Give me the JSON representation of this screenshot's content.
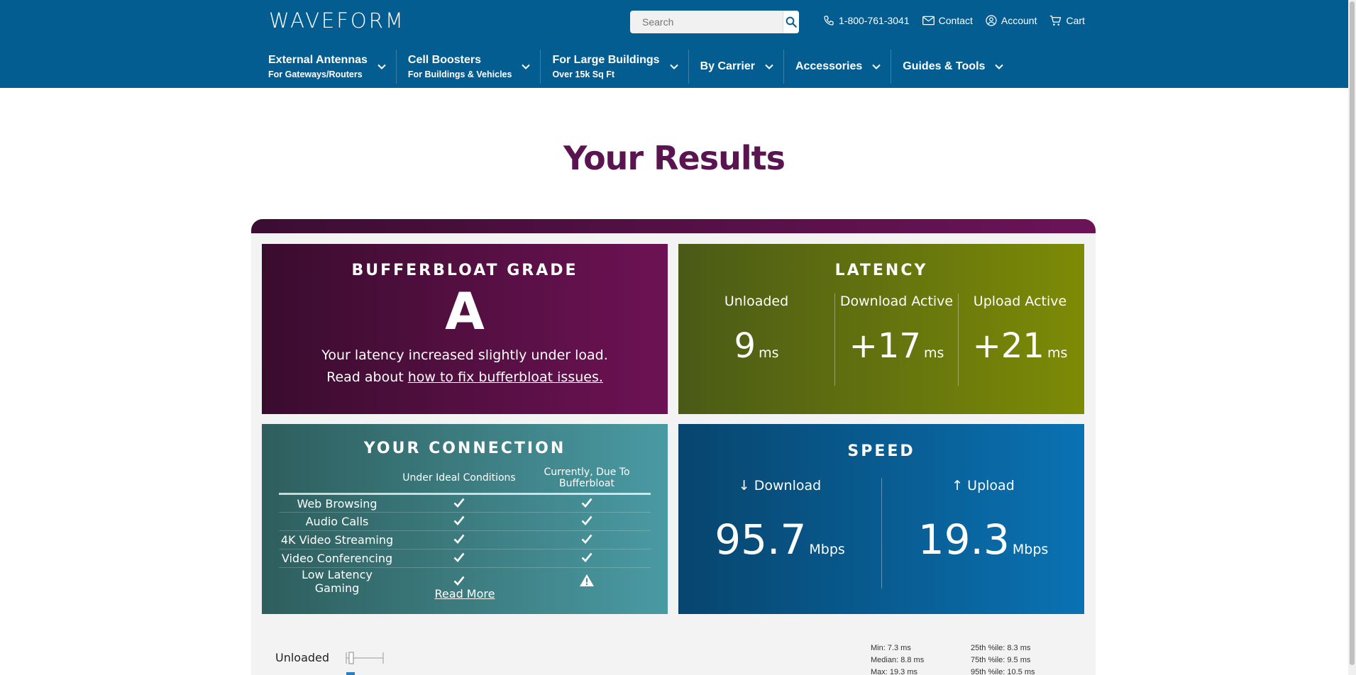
{
  "header": {
    "logo": "WAVEFORM",
    "search": {
      "placeholder": "Search"
    },
    "links": {
      "phone": "1-800-761-3041",
      "contact": "Contact",
      "account": "Account",
      "cart": "Cart"
    },
    "nav": [
      {
        "main": "External Antennas",
        "sub": "For Gateways/Routers"
      },
      {
        "main": "Cell Boosters",
        "sub": "For Buildings & Vehicles"
      },
      {
        "main": "For Large Buildings",
        "sub": "Over 15k Sq Ft"
      },
      {
        "main": "By Carrier",
        "sub": ""
      },
      {
        "main": "Accessories",
        "sub": ""
      },
      {
        "main": "Guides & Tools",
        "sub": ""
      }
    ]
  },
  "page": {
    "title": "Your Results"
  },
  "grade": {
    "heading": "BUFFERBLOAT GRADE",
    "value": "A",
    "message": "Your latency increased slightly under load.",
    "read_prefix": "Read about ",
    "link": "how to fix bufferbloat issues."
  },
  "latency": {
    "heading": "LATENCY",
    "columns": [
      {
        "label": "Unloaded",
        "value": "9",
        "unit": "ms"
      },
      {
        "label": "Download Active",
        "value": "+17",
        "unit": "ms"
      },
      {
        "label": "Upload Active",
        "value": "+21",
        "unit": "ms"
      }
    ]
  },
  "connection": {
    "heading": "YOUR CONNECTION",
    "col_ideal": "Under Ideal Conditions",
    "col_current": "Currently, Due To Bufferbloat",
    "rows": [
      {
        "name": "Web Browsing",
        "ideal": "check",
        "current": "check"
      },
      {
        "name": "Audio Calls",
        "ideal": "check",
        "current": "check"
      },
      {
        "name": "4K Video Streaming",
        "ideal": "check",
        "current": "check"
      },
      {
        "name": "Video Conferencing",
        "ideal": "check",
        "current": "check"
      },
      {
        "name": "Low Latency Gaming",
        "ideal": "check",
        "current": "warning"
      }
    ],
    "read_more": "Read More"
  },
  "speed": {
    "heading": "SPEED",
    "download": {
      "label": "↓ Download",
      "value": "95.7",
      "unit": "Mbps"
    },
    "upload": {
      "label": "↑ Upload",
      "value": "19.3",
      "unit": "Mbps"
    }
  },
  "stats": {
    "label": "Unloaded",
    "left": [
      "Min: 7.3 ms",
      "Median: 8.8 ms",
      "Max: 19.3 ms"
    ],
    "right": [
      "25th %ile: 8.3 ms",
      "75th %ile: 9.5 ms",
      "95th %ile: 10.5 ms"
    ]
  },
  "icons": {
    "search": "search-icon",
    "phone": "phone-icon",
    "contact": "mail-icon",
    "account": "user-icon",
    "cart": "cart-icon",
    "chevron": "chevron-down-icon",
    "check": "check-icon",
    "warning": "warning-icon"
  },
  "colors": {
    "header": "#045d91",
    "title": "#5a1450",
    "grade": "#6d1254",
    "latency": "#7d8b06",
    "connection": "#4a9aa3",
    "speed": "#0a72b3"
  }
}
